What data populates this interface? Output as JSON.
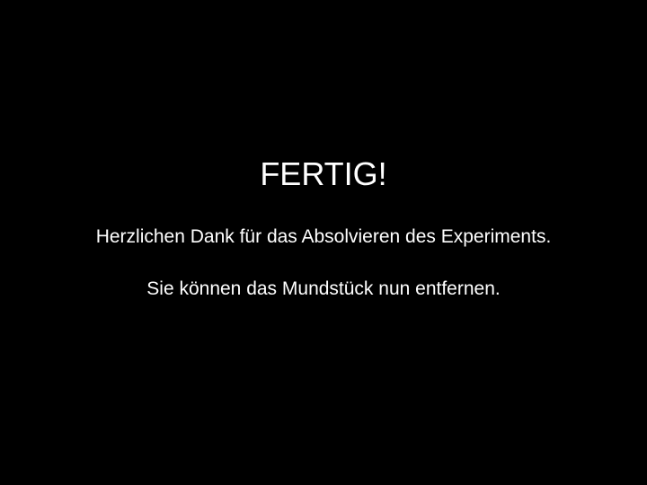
{
  "screen": {
    "background_color": "#000000",
    "text_color": "#ffffff",
    "heading": "FERTIG!",
    "thanks_message": "Herzlichen Dank für das Absolvieren des Experiments.",
    "instruction": "Sie können das Mundstück nun entfernen."
  }
}
